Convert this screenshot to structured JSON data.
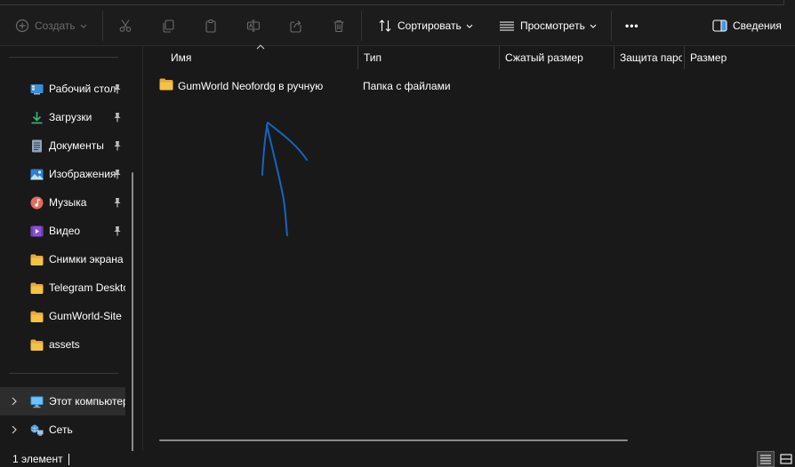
{
  "toolbar": {
    "create_label": "Создать",
    "sort_label": "Сортировать",
    "view_label": "Просмотреть",
    "more_label": "•••",
    "details_label": "Сведения"
  },
  "sidebar": {
    "quick_access": [
      {
        "label": "Рабочий стол",
        "icon": "desktop-icon",
        "pinned": true
      },
      {
        "label": "Загрузки",
        "icon": "downloads-icon",
        "pinned": true
      },
      {
        "label": "Документы",
        "icon": "documents-icon",
        "pinned": true
      },
      {
        "label": "Изображения",
        "icon": "pictures-icon",
        "pinned": true
      },
      {
        "label": "Музыка",
        "icon": "music-icon",
        "pinned": true
      },
      {
        "label": "Видео",
        "icon": "videos-icon",
        "pinned": true
      },
      {
        "label": "Снимки экрана",
        "icon": "folder-icon",
        "pinned": false
      },
      {
        "label": "Telegram Desktop",
        "icon": "folder-icon",
        "pinned": false
      },
      {
        "label": "GumWorld-Site",
        "icon": "folder-icon",
        "pinned": false
      },
      {
        "label": "assets",
        "icon": "folder-icon",
        "pinned": false
      }
    ],
    "this_pc_label": "Этот компьютер",
    "network_label": "Сеть"
  },
  "columns": {
    "name": "Имя",
    "type": "Тип",
    "compressed_size": "Сжатый размер",
    "protection": "Защита паролем",
    "size": "Размер"
  },
  "files": [
    {
      "name": "GumWorld Neofordg в ручную",
      "type": "Папка с файлами"
    }
  ],
  "status": {
    "item_count": "1 элемент"
  },
  "colors": {
    "background": "#191919",
    "toolbar": "#1c1c1c",
    "folder": "#f4c244",
    "annotation": "#1565c0",
    "selected": "#2d2d2d"
  }
}
